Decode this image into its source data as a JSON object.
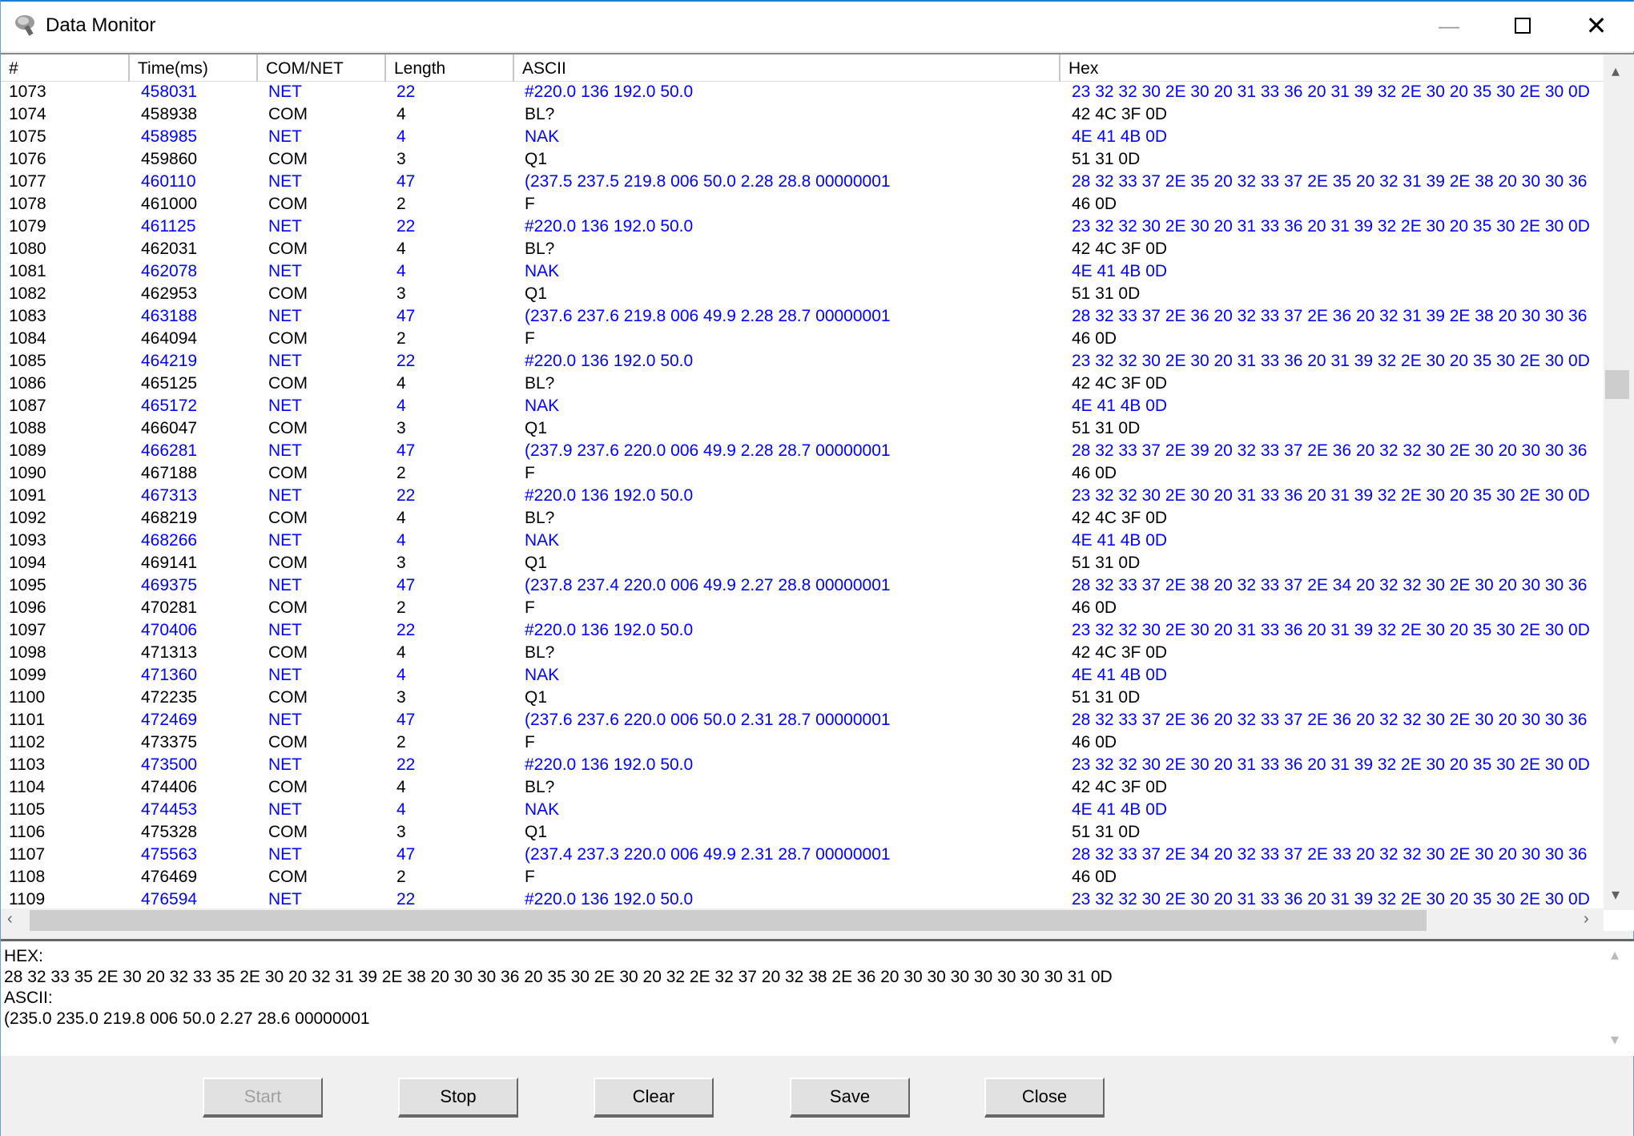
{
  "window": {
    "title": "Data Monitor",
    "minimize_icon": "minimize-icon",
    "maximize_icon": "maximize-icon",
    "close_icon": "close-icon"
  },
  "colors": {
    "net": "#0000ff",
    "com": "#000000",
    "title_border": "#1a7fd4"
  },
  "table": {
    "columns": [
      "#",
      "Time(ms)",
      "COM/NET",
      "Length",
      "ASCII",
      "Hex"
    ],
    "rows": [
      [
        "1073",
        "458031",
        "NET",
        "22",
        "#220.0 136 192.0 50.0",
        "23 32 32 30 2E 30 20 31 33 36 20 31 39 32 2E 30 20 35 30 2E 30 0D"
      ],
      [
        "1074",
        "458938",
        "COM",
        "4",
        "BL?",
        "42 4C 3F 0D"
      ],
      [
        "1075",
        "458985",
        "NET",
        "4",
        "NAK",
        "4E 41 4B 0D"
      ],
      [
        "1076",
        "459860",
        "COM",
        "3",
        "Q1",
        "51 31 0D"
      ],
      [
        "1077",
        "460110",
        "NET",
        "47",
        "(237.5 237.5 219.8 006 50.0 2.28 28.8 00000001",
        "28 32 33 37 2E 35 20 32 33 37 2E 35 20 32 31 39 2E 38 20 30 30 36"
      ],
      [
        "1078",
        "461000",
        "COM",
        "2",
        "F",
        "46 0D"
      ],
      [
        "1079",
        "461125",
        "NET",
        "22",
        "#220.0 136 192.0 50.0",
        "23 32 32 30 2E 30 20 31 33 36 20 31 39 32 2E 30 20 35 30 2E 30 0D"
      ],
      [
        "1080",
        "462031",
        "COM",
        "4",
        "BL?",
        "42 4C 3F 0D"
      ],
      [
        "1081",
        "462078",
        "NET",
        "4",
        "NAK",
        "4E 41 4B 0D"
      ],
      [
        "1082",
        "462953",
        "COM",
        "3",
        "Q1",
        "51 31 0D"
      ],
      [
        "1083",
        "463188",
        "NET",
        "47",
        "(237.6 237.6 219.8 006 49.9 2.28 28.7 00000001",
        "28 32 33 37 2E 36 20 32 33 37 2E 36 20 32 31 39 2E 38 20 30 30 36"
      ],
      [
        "1084",
        "464094",
        "COM",
        "2",
        "F",
        "46 0D"
      ],
      [
        "1085",
        "464219",
        "NET",
        "22",
        "#220.0 136 192.0 50.0",
        "23 32 32 30 2E 30 20 31 33 36 20 31 39 32 2E 30 20 35 30 2E 30 0D"
      ],
      [
        "1086",
        "465125",
        "COM",
        "4",
        "BL?",
        "42 4C 3F 0D"
      ],
      [
        "1087",
        "465172",
        "NET",
        "4",
        "NAK",
        "4E 41 4B 0D"
      ],
      [
        "1088",
        "466047",
        "COM",
        "3",
        "Q1",
        "51 31 0D"
      ],
      [
        "1089",
        "466281",
        "NET",
        "47",
        "(237.9 237.6 220.0 006 49.9 2.28 28.7 00000001",
        "28 32 33 37 2E 39 20 32 33 37 2E 36 20 32 32 30 2E 30 20 30 30 36"
      ],
      [
        "1090",
        "467188",
        "COM",
        "2",
        "F",
        "46 0D"
      ],
      [
        "1091",
        "467313",
        "NET",
        "22",
        "#220.0 136 192.0 50.0",
        "23 32 32 30 2E 30 20 31 33 36 20 31 39 32 2E 30 20 35 30 2E 30 0D"
      ],
      [
        "1092",
        "468219",
        "COM",
        "4",
        "BL?",
        "42 4C 3F 0D"
      ],
      [
        "1093",
        "468266",
        "NET",
        "4",
        "NAK",
        "4E 41 4B 0D"
      ],
      [
        "1094",
        "469141",
        "COM",
        "3",
        "Q1",
        "51 31 0D"
      ],
      [
        "1095",
        "469375",
        "NET",
        "47",
        "(237.8 237.4 220.0 006 49.9 2.27 28.8 00000001",
        "28 32 33 37 2E 38 20 32 33 37 2E 34 20 32 32 30 2E 30 20 30 30 36"
      ],
      [
        "1096",
        "470281",
        "COM",
        "2",
        "F",
        "46 0D"
      ],
      [
        "1097",
        "470406",
        "NET",
        "22",
        "#220.0 136 192.0 50.0",
        "23 32 32 30 2E 30 20 31 33 36 20 31 39 32 2E 30 20 35 30 2E 30 0D"
      ],
      [
        "1098",
        "471313",
        "COM",
        "4",
        "BL?",
        "42 4C 3F 0D"
      ],
      [
        "1099",
        "471360",
        "NET",
        "4",
        "NAK",
        "4E 41 4B 0D"
      ],
      [
        "1100",
        "472235",
        "COM",
        "3",
        "Q1",
        "51 31 0D"
      ],
      [
        "1101",
        "472469",
        "NET",
        "47",
        "(237.6 237.6 220.0 006 50.0 2.31 28.7 00000001",
        "28 32 33 37 2E 36 20 32 33 37 2E 36 20 32 32 30 2E 30 20 30 30 36"
      ],
      [
        "1102",
        "473375",
        "COM",
        "2",
        "F",
        "46 0D"
      ],
      [
        "1103",
        "473500",
        "NET",
        "22",
        "#220.0 136 192.0 50.0",
        "23 32 32 30 2E 30 20 31 33 36 20 31 39 32 2E 30 20 35 30 2E 30 0D"
      ],
      [
        "1104",
        "474406",
        "COM",
        "4",
        "BL?",
        "42 4C 3F 0D"
      ],
      [
        "1105",
        "474453",
        "NET",
        "4",
        "NAK",
        "4E 41 4B 0D"
      ],
      [
        "1106",
        "475328",
        "COM",
        "3",
        "Q1",
        "51 31 0D"
      ],
      [
        "1107",
        "475563",
        "NET",
        "47",
        "(237.4 237.3 220.0 006 49.9 2.31 28.7 00000001",
        "28 32 33 37 2E 34 20 32 33 37 2E 33 20 32 32 30 2E 30 20 30 30 36"
      ],
      [
        "1108",
        "476469",
        "COM",
        "2",
        "F",
        "46 0D"
      ],
      [
        "1109",
        "476594",
        "NET",
        "22",
        "#220.0 136 192.0 50.0",
        "23 32 32 30 2E 30 20 31 33 36 20 31 39 32 2E 30 20 35 30 2E 30 0D"
      ]
    ]
  },
  "detail": {
    "hex_label": "HEX:",
    "hex": "28 32 33 35 2E 30 20 32 33 35 2E 30 20 32 31 39 2E 38 20 30 30 36 20 35 30 2E 30 20 32 2E 32 37 20 32 38 2E 36 20 30 30 30 30 30 30 30 31 0D",
    "ascii_label": "ASCII:",
    "ascii": "(235.0 235.0 219.8 006 50.0 2.27 28.6 00000001"
  },
  "buttons": {
    "start": "Start",
    "stop": "Stop",
    "clear": "Clear",
    "save": "Save",
    "close": "Close",
    "start_disabled": true
  }
}
